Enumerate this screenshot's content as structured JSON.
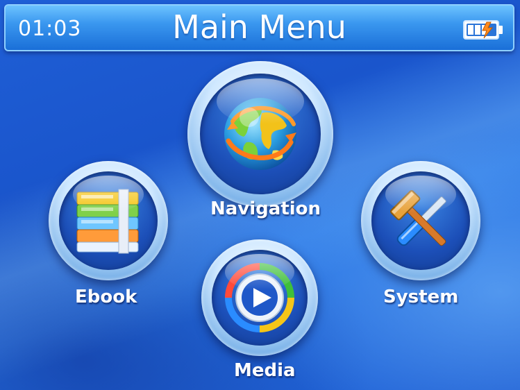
{
  "header": {
    "time": "01:03",
    "title": "Main Menu",
    "battery_icon": "battery-icon"
  },
  "menu": {
    "navigation": {
      "label": "Navigation",
      "icon": "globe-icon"
    },
    "ebook": {
      "label": "Ebook",
      "icon": "books-icon"
    },
    "system": {
      "label": "System",
      "icon": "tools-icon"
    },
    "media": {
      "label": "Media",
      "icon": "play-icon"
    }
  },
  "colors": {
    "background": "#1f5fd6",
    "header": "#3a97ef",
    "text": "#ffffff"
  }
}
